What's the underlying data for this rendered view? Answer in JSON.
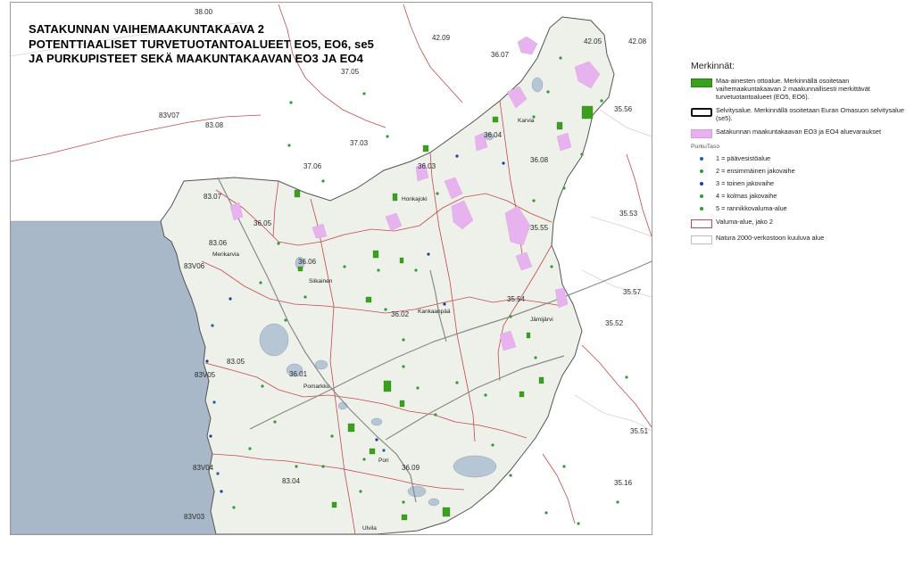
{
  "title": {
    "line1": "SATAKUNNAN VAIHEMAAKUNTAKAAVA 2",
    "line2": "POTENTTIAALISET TURVETUOTANTOALUEET EO5, EO6, se5",
    "line3": "JA PURKUPISTEET SEKÄ MAAKUNTAKAAVAN EO3 JA EO4"
  },
  "map": {
    "area_codes": [
      "38.00",
      "42.09",
      "42.05",
      "42.08",
      "36.07",
      "37.05",
      "83V07",
      "83.08",
      "36.04",
      "35.56",
      "37.03",
      "37.06",
      "36.03",
      "36.08",
      "83.07",
      "36.05",
      "35.53",
      "83.06",
      "35.55",
      "83V06",
      "36.06",
      "35.57",
      "35.54",
      "36.02",
      "35.52",
      "83.05",
      "83V05",
      "36.01",
      "35.51",
      "83V04",
      "36.09",
      "35.16",
      "83.04",
      "83V03"
    ],
    "place_names": [
      "Karvia",
      "Honkajoki",
      "Merikarvia",
      "Siikainen",
      "Kankaanpää",
      "Jämijärvi",
      "Pomarkku",
      "Pori",
      "Ulvila"
    ]
  },
  "legend": {
    "heading": "Merkinnät:",
    "items": [
      {
        "text": "Maa-ainesten ottoalue. Merkinnällä osoitetaan vaihemaakuntakaavan 2 maakunnallisesti merkittävät turvetuotantoalueet (EO5, EO6)."
      },
      {
        "text": "Selvitysalue. Merkinnällä osoitetaan Euran Omasuon selvitysalue (se5)."
      },
      {
        "text": "Satakunnan maakuntakaavan EO3 ja EO4 aluevaraukset"
      }
    ],
    "purku_heading": "PurkuTaso",
    "purku_levels": [
      {
        "text": "1 = päävesistöalue",
        "color": "#1f5fb0"
      },
      {
        "text": "2 = ensimmäinen jakovaihe",
        "color": "#2f9a3a"
      },
      {
        "text": "3 = toinen jakovaihe",
        "color": "#1f3f9a"
      },
      {
        "text": "4 = kolmas jakovaihe",
        "color": "#2f9a3a"
      },
      {
        "text": "5 = rannikkovaluma-alue",
        "color": "#2f9a3a"
      }
    ],
    "boundaries": [
      {
        "text": "Valuma-alue, jako 2"
      },
      {
        "text": "Natura 2000-verkostoon kuuluva alue"
      }
    ]
  },
  "colors": {
    "sea": "#a8b8c8",
    "region": "#eef0ea",
    "peat_green": "#3aa01e",
    "eo_pink": "#e7b3ee",
    "boundary_red": "#c44a4a",
    "water": "#b6c6d4"
  }
}
